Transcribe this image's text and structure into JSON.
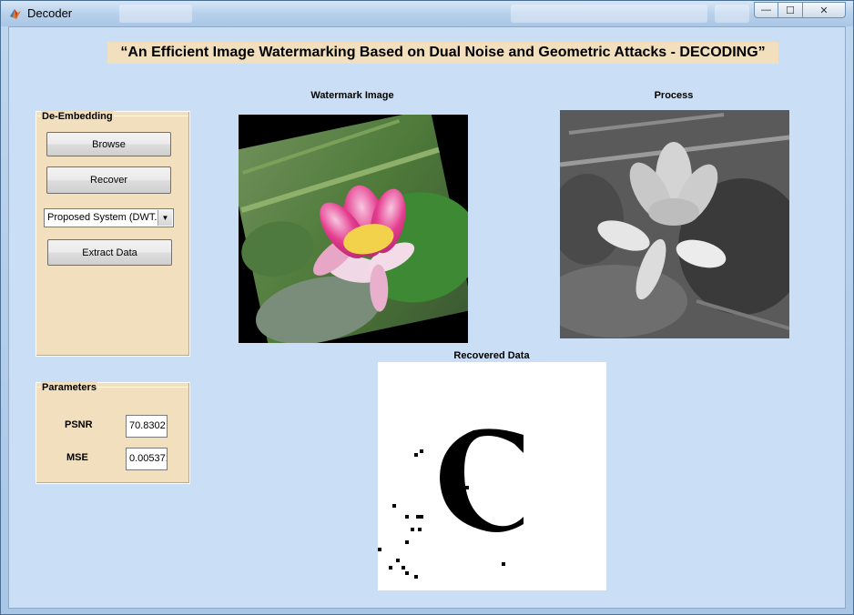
{
  "window": {
    "title": "Decoder",
    "app_icon": "matlab-icon",
    "controls": {
      "minimize": "—",
      "maximize": "☐",
      "close": "✕"
    }
  },
  "banner": {
    "text": "“An Efficient Image Watermarking Based on Dual Noise and Geometric Attacks - DECODING”"
  },
  "de_embedding": {
    "title": "De-Embedding",
    "browse_label": "Browse",
    "recover_label": "Recover",
    "method_selected": "Proposed System (DWT",
    "extract_label": "Extract Data"
  },
  "parameters": {
    "title": "Parameters",
    "psnr_label": "PSNR",
    "psnr_value": "70.8302",
    "mse_label": "MSE",
    "mse_value": "0.005371"
  },
  "axes": {
    "watermark_title": "Watermark Image",
    "process_title": "Process",
    "recovered_title": "Recovered Data"
  },
  "colors": {
    "panel_bg": "#f2dfbd",
    "client_bg": "#cadff6",
    "accent": "#e53d8f"
  }
}
